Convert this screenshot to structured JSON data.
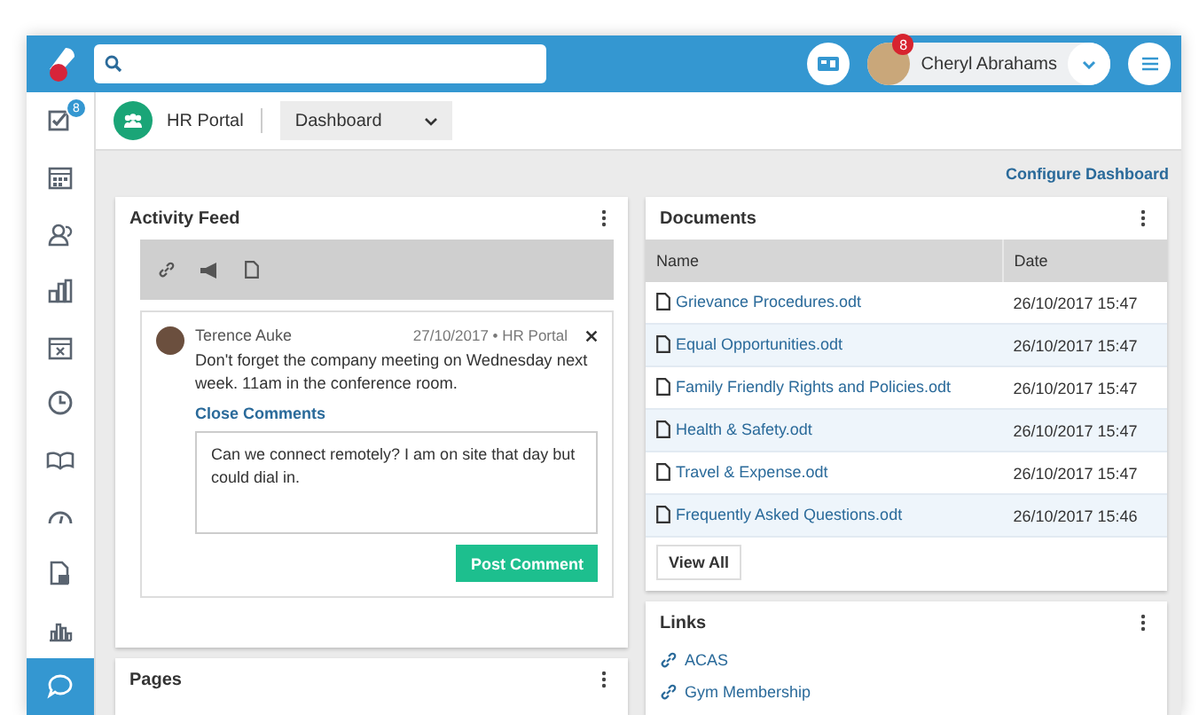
{
  "header": {
    "user": {
      "name": "Cheryl Abrahams",
      "badge": "8"
    }
  },
  "sidebar": {
    "items": [
      {
        "kind": "tasks",
        "badge": "8",
        "selected": false
      },
      {
        "kind": "calendar",
        "selected": false
      },
      {
        "kind": "people",
        "selected": false
      },
      {
        "kind": "org",
        "selected": false
      },
      {
        "kind": "calendar-x",
        "selected": false
      },
      {
        "kind": "clock",
        "selected": false
      },
      {
        "kind": "book",
        "selected": false
      },
      {
        "kind": "gauge",
        "selected": false
      },
      {
        "kind": "document",
        "selected": false
      },
      {
        "kind": "chart",
        "selected": false
      },
      {
        "kind": "chat",
        "selected": true
      }
    ]
  },
  "subheader": {
    "site": "HR Portal",
    "view": "Dashboard"
  },
  "configure_link": "Configure Dashboard",
  "activity_feed": {
    "title": "Activity Feed",
    "post": {
      "author": "Terence Auke",
      "meta": "27/10/2017 • HR Portal",
      "text": "Don't forget the company meeting on Wednesday next week. 11am in the conference room.",
      "close_comments": "Close Comments",
      "comment": {
        "value": "Can we connect remotely? I am on site that day but could dial in."
      },
      "button": "Post Comment"
    }
  },
  "pages": {
    "title": "Pages"
  },
  "documents": {
    "title": "Documents",
    "columns": [
      "Name",
      "Date"
    ],
    "rows": [
      {
        "name": "Grievance Procedures.odt",
        "date": "26/10/2017 15:47"
      },
      {
        "name": "Equal Opportunities.odt",
        "date": "26/10/2017 15:47"
      },
      {
        "name": "Family Friendly Rights and Policies.odt",
        "date": "26/10/2017 15:47"
      },
      {
        "name": "Health & Safety.odt",
        "date": "26/10/2017 15:47"
      },
      {
        "name": "Travel & Expense.odt",
        "date": "26/10/2017 15:47"
      },
      {
        "name": "Frequently Asked Questions.odt",
        "date": "26/10/2017 15:46"
      }
    ],
    "button": "View All"
  },
  "links": {
    "title": "Links",
    "items": [
      "ACAS",
      "Gym Membership"
    ]
  }
}
